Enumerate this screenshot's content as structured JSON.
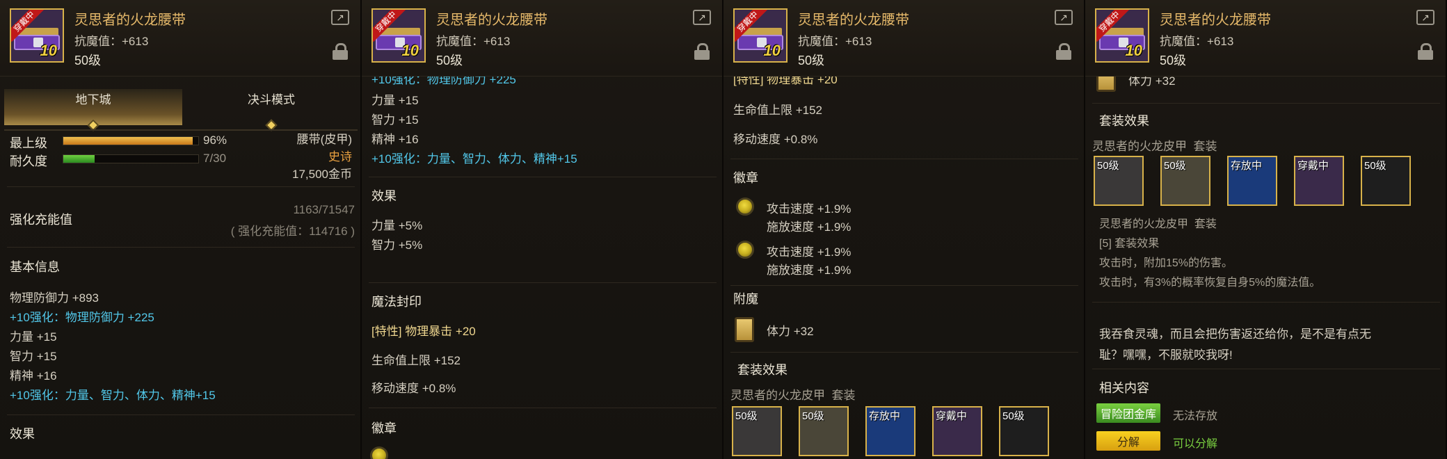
{
  "item": {
    "name": "灵思者的火龙腰带",
    "stat": "抗魔值：+613",
    "level": "50级",
    "ribbon": "穿戴中",
    "badge_num": "10"
  },
  "p1": {
    "tab_dungeon": "地下城",
    "tab_duel": "决斗模式",
    "max_level_label": "最上级",
    "max_level_value": "96%",
    "max_level_progress": 0.96,
    "durability_label": "耐久度",
    "durability_value": "7/30",
    "durability_progress": 0.233,
    "type": "腰带(皮甲)",
    "rarity": "史诗",
    "price": "17,500金币",
    "charge_label": "强化充能值",
    "charge_value": "1163/71547",
    "charge_sub": "( 强化充能值：114716 )",
    "basic_title": "基本信息",
    "basic": [
      "物理防御力 +893",
      "+10强化：物理防御力 +225",
      "力量 +15",
      "智力 +15",
      "精神 +16",
      "+10强化：力量、智力、体力、精神+15"
    ],
    "effect_title": "效果"
  },
  "p2": {
    "top_partial": "+10强化：物理防御力 +225",
    "stats": [
      "力量 +15",
      "智力 +15",
      "精神 +16",
      "+10强化：力量、智力、体力、精神+15"
    ],
    "effect_title": "效果",
    "effects": [
      "力量 +5%",
      "智力 +5%"
    ],
    "seal_title": "魔法封印",
    "seal_tag": "[特性]",
    "seal_main": "物理暴击 +20",
    "seal_items": [
      "生命值上限 +152",
      "移动速度 +0.8%"
    ],
    "emblem_title": "徽章"
  },
  "p3": {
    "top_partial": "[特性] 物理暴击 +20",
    "items": [
      "生命值上限 +152",
      "移动速度 +0.8%"
    ],
    "emblem_title": "徽章",
    "emblems": [
      {
        "a": "攻击速度 +1.9%",
        "b": "施放速度 +1.9%"
      },
      {
        "a": "攻击速度 +1.9%",
        "b": "施放速度 +1.9%"
      }
    ],
    "enchant_title": "附魔",
    "enchant": "体力 +32",
    "set_title": "套装效果",
    "set_name": "灵思者的火龙皮甲",
    "set_suffix": "套装",
    "badges": [
      "50级",
      "50级",
      "存放中",
      "穿戴中",
      "50级"
    ]
  },
  "p4": {
    "top_partial": "体力 +32",
    "set_title": "套装效果",
    "set_name": "灵思者的火龙皮甲",
    "set_suffix": "套装",
    "badges": [
      "50级",
      "50级",
      "存放中",
      "穿戴中",
      "50级"
    ],
    "set_name2": "灵思者的火龙皮甲",
    "set_suffix2": "套装",
    "set_count": "[5] 套装效果",
    "set_effects": [
      "攻击时，附加15%的伤害。",
      "攻击时，有3%的概率恢复自身5%的魔法值。"
    ],
    "quote1": "我吞食灵魂，而且会把伤害返还给你，是不是有点无",
    "quote2": "耻？嘿嘿，不服就咬我呀!",
    "related_title": "相关内容",
    "bank_btn": "冒险团金库",
    "bank_text": "无法存放",
    "disasm_btn": "分解",
    "disasm_text": "可以分解"
  },
  "colors": {
    "cyan": "#52c8ea",
    "gold": "#e6b96a",
    "epic": "#e8a040",
    "green": "#7ad040"
  }
}
